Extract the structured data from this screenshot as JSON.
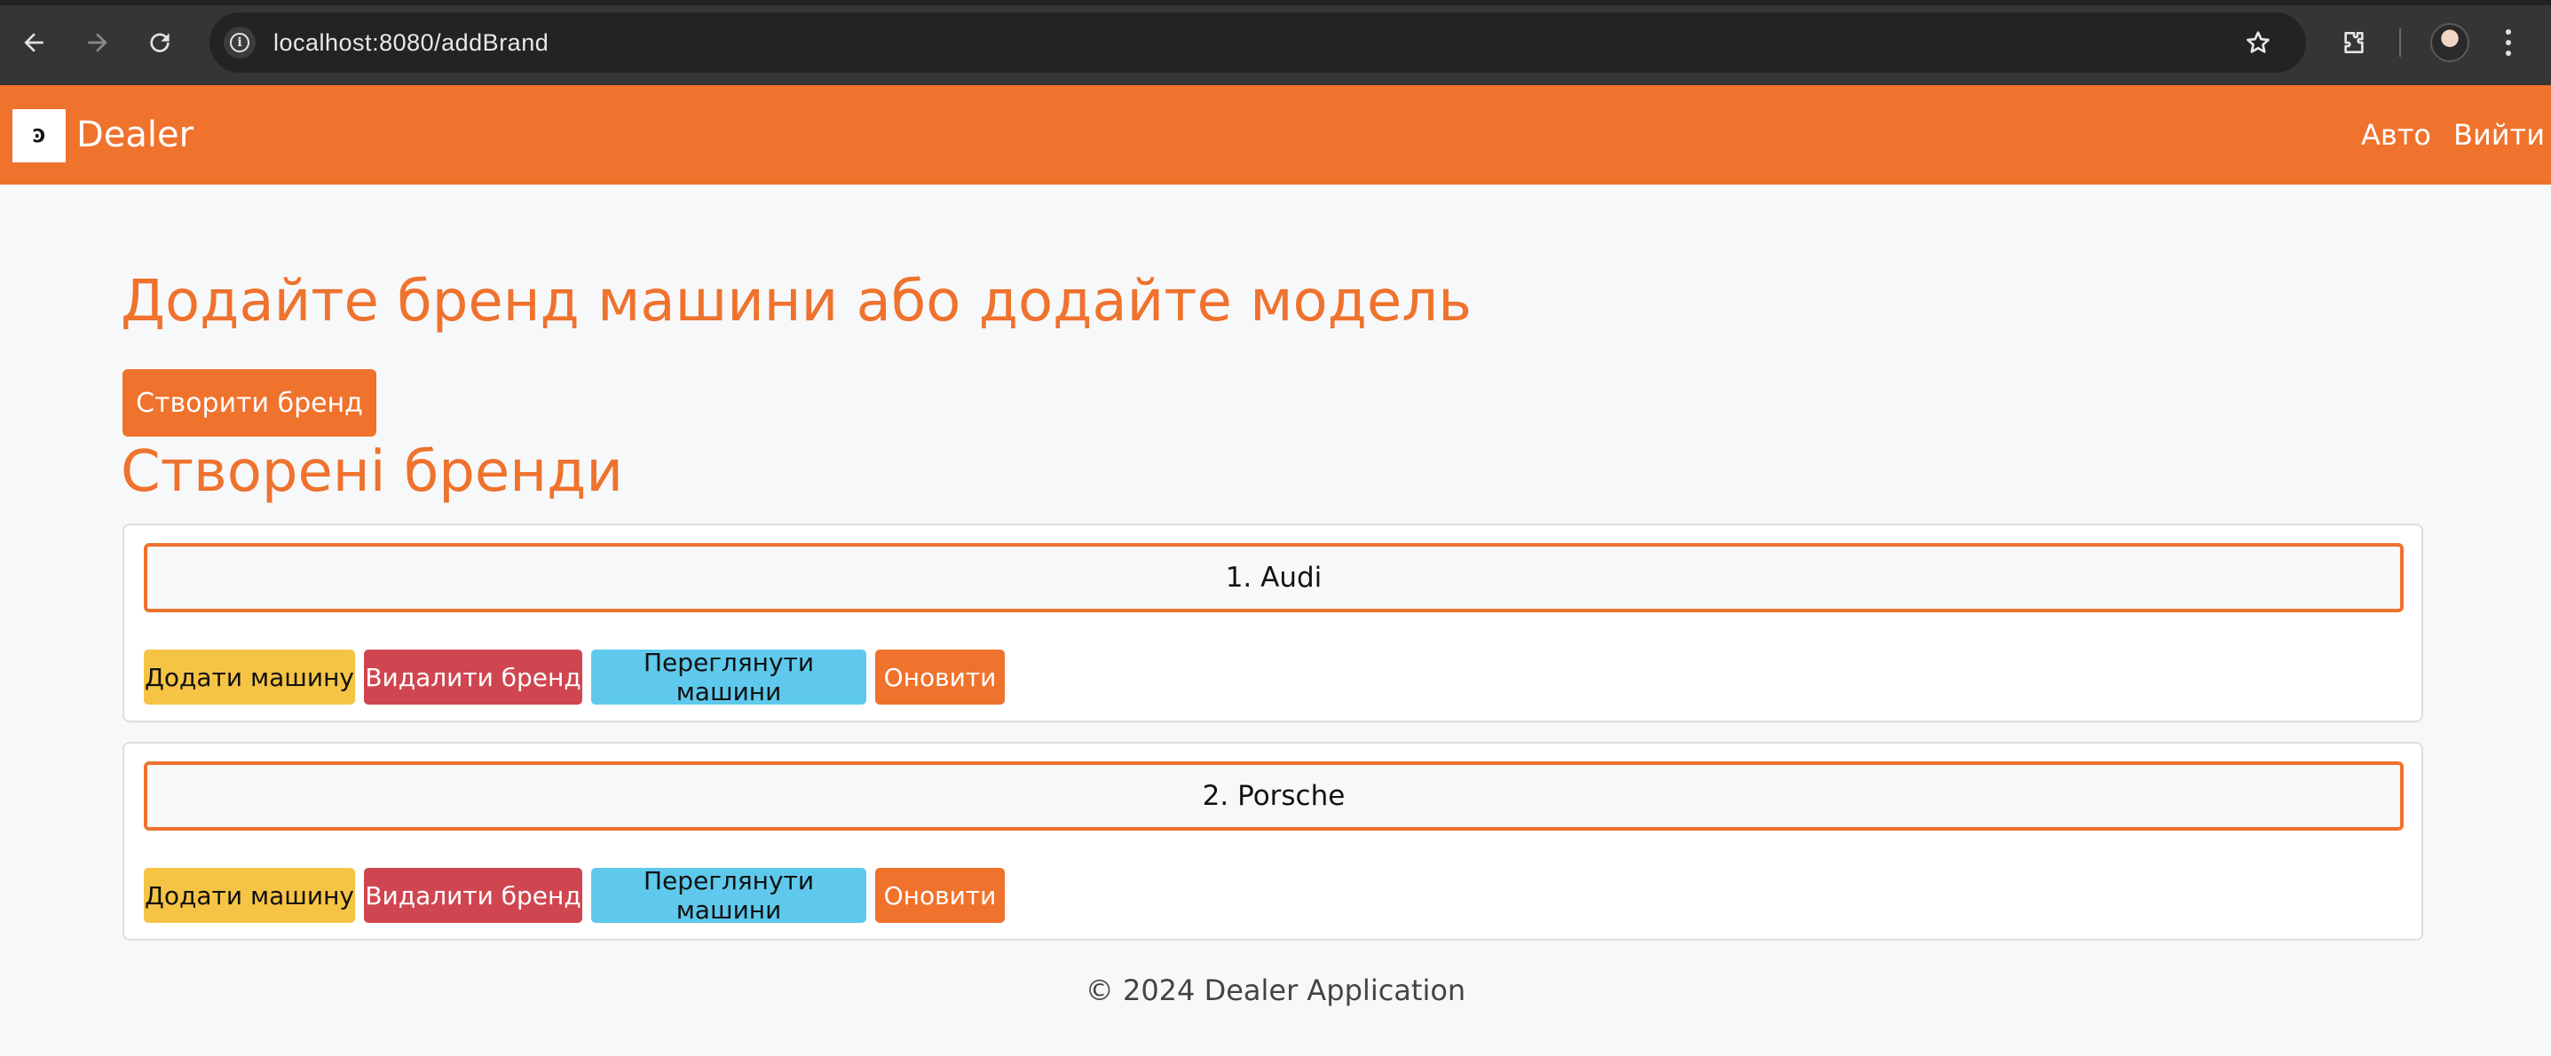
{
  "browser": {
    "url": "localhost:8080/addBrand",
    "icons": {
      "back": "arrow-left-icon",
      "forward": "arrow-right-icon",
      "reload": "reload-icon",
      "site_info": "info-icon",
      "bookmark": "star-icon",
      "extensions": "puzzle-icon",
      "menu": "kebab-menu-icon"
    }
  },
  "navbar": {
    "brand_name": "Dealer",
    "links": [
      {
        "label": "Авто"
      },
      {
        "label": "Вийти"
      }
    ],
    "color": "#ef722d"
  },
  "main": {
    "title": "Додайте бренд машини або додайте модель",
    "create_button": "Створити бренд",
    "section_title": "Створені бренди",
    "brands": [
      {
        "label": "1. Audi",
        "actions": {
          "add": "Додати машину",
          "delete": "Видалити бренд",
          "view": "Переглянути машини",
          "update": "Оновити"
        }
      },
      {
        "label": "2. Porsche",
        "actions": {
          "add": "Додати машину",
          "delete": "Видалити бренд",
          "view": "Переглянути машини",
          "update": "Оновити"
        }
      }
    ]
  },
  "footer": {
    "text": "© 2024 Dealer Application"
  },
  "colors": {
    "accent": "#ef722d",
    "warning": "#f6c444",
    "danger": "#d04650",
    "info": "#5ec9ec"
  }
}
